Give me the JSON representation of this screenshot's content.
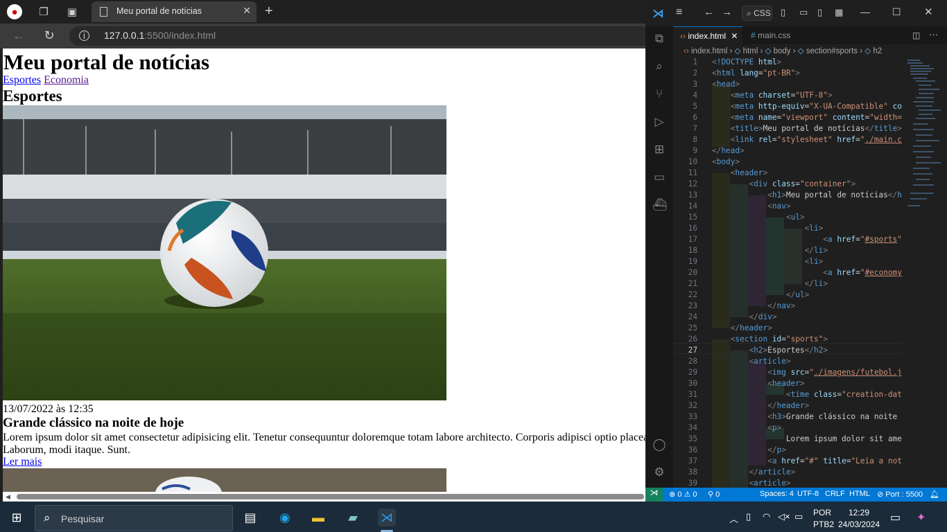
{
  "browser": {
    "tab_title": "Meu portal de notícias",
    "url_host": "127.0.0.1",
    "url_rest": ":5500/index.html",
    "page": {
      "h1": "Meu portal de notícias",
      "nav": [
        "Esportes",
        "Economia"
      ],
      "section_title": "Esportes",
      "article_date": "13/07/2022 às 12:35",
      "article_title": "Grande clássico na noite de hoje",
      "article_text": "Lorem ipsum dolor sit amet consectetur adipisicing elit. Tenetur consequuntur doloremque totam labore architecto. Corporis adipisci optio placea Laborum, modi itaque. Sunt.",
      "read_more": "Ler mais"
    }
  },
  "vscode": {
    "search": "CSS",
    "tabs": [
      "index.html",
      "main.css"
    ],
    "breadcrumb": [
      "index.html",
      "html",
      "body",
      "section#sports",
      "h2"
    ],
    "code_lines": [
      "1",
      "2",
      "3",
      "4",
      "5",
      "6",
      "7",
      "8",
      "9",
      "10",
      "11",
      "12",
      "13",
      "14",
      "15",
      "16",
      "17",
      "18",
      "19",
      "20",
      "21",
      "22",
      "23",
      "24",
      "25",
      "26",
      "27",
      "28",
      "29",
      "30",
      "31",
      "32",
      "33",
      "34",
      "35",
      "36",
      "37",
      "38",
      "39"
    ],
    "current_line": "27",
    "status": {
      "errors": "0",
      "warnings": "0",
      "ports": "0",
      "spaces": "Spaces: 4",
      "encoding": "UTF-8",
      "eol": "CRLF",
      "language": "HTML",
      "port": "Port : 5500"
    }
  },
  "taskbar": {
    "search_placeholder": "Pesquisar",
    "lang": "POR",
    "layout": "PTB2",
    "time": "12:29",
    "date": "24/03/2024"
  }
}
